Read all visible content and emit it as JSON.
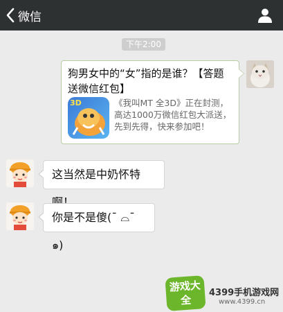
{
  "header": {
    "back_label": "微信",
    "back_icon": "chevron-left-icon",
    "profile_icon": "person-icon"
  },
  "chat": {
    "timestamp": "下午2:00",
    "sent_card": {
      "title": "狗男女中的“女”指的是谁？【答题送微信红包】",
      "description": "《我叫MT 全3D》正在封测，高达1000万微信红包大派送，先到先得，快来参加吧！",
      "thumb_badge": "3D"
    },
    "received": [
      {
        "text": "这当然是中奶怀特啊！"
      },
      {
        "text": "你是不是傻(¯ ⌓¯ ๑)"
      }
    ]
  },
  "watermark": {
    "logo_text": "游戏大全",
    "brand": "4399手机游戏网",
    "url": "www.4399.cn"
  }
}
